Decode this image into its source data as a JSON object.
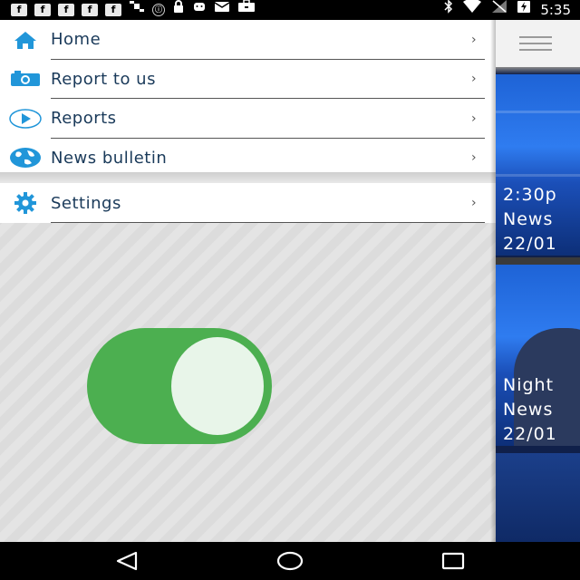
{
  "status_bar": {
    "time": "5:35",
    "notification_icons": [
      "f",
      "f",
      "f",
      "f",
      "f",
      "satellite-icon",
      "circle-icon",
      "lock-icon",
      "android-icon",
      "mail-icon",
      "briefcase-icon"
    ]
  },
  "drawer": {
    "menu": [
      {
        "label": "Home",
        "icon": "home-icon",
        "name": "menu-item-home"
      },
      {
        "label": "Report to us",
        "icon": "camera-icon",
        "name": "menu-item-report-to-us"
      },
      {
        "label": "Reports",
        "icon": "play-icon",
        "name": "menu-item-reports"
      },
      {
        "label": "News bulletin",
        "icon": "globe-icon",
        "name": "menu-item-news-bulletin"
      }
    ],
    "settings": {
      "label": "Settings",
      "icon": "gear-icon"
    },
    "chevron": "›",
    "toggle": {
      "state": "on",
      "color": "#4caf50"
    }
  },
  "content": {
    "cards": [
      {
        "line1": "2:30p",
        "line2": "News",
        "line3": "22/01"
      },
      {
        "line1": "Night",
        "line2": "News",
        "line3": "22/01"
      }
    ]
  },
  "colors": {
    "icon_blue": "#2196d9",
    "label": "#1a3a5a",
    "toggle_green": "#4caf50"
  }
}
